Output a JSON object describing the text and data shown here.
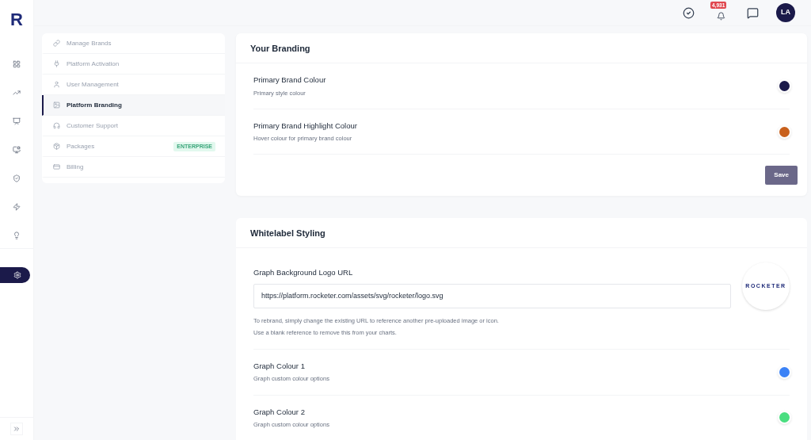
{
  "logo": "R",
  "rail": [
    {
      "kind": "grid",
      "selected": false
    },
    {
      "kind": "chart",
      "selected": false
    },
    {
      "kind": "tag",
      "selected": false
    },
    {
      "kind": "monitor",
      "selected": false
    },
    {
      "kind": "shield",
      "selected": false
    },
    {
      "kind": "zap",
      "selected": false
    },
    {
      "kind": "bulb",
      "selected": false
    },
    {
      "kind": "settings",
      "selected": true
    }
  ],
  "header": {
    "notification_count": "4,931",
    "avatar": "LA"
  },
  "settings_menu": [
    {
      "label": "Manage Brands",
      "kind": "link",
      "selected": false
    },
    {
      "label": "Platform Activation",
      "kind": "plug",
      "selected": false
    },
    {
      "label": "User Management",
      "kind": "user",
      "selected": false
    },
    {
      "label": "Platform Branding",
      "kind": "image",
      "selected": true
    },
    {
      "label": "Customer Support",
      "kind": "headphones",
      "selected": false
    },
    {
      "label": "Packages",
      "kind": "package",
      "selected": false,
      "badge": "ENTERPRISE"
    },
    {
      "label": "Billing",
      "kind": "billing",
      "selected": false
    }
  ],
  "branding": {
    "title": "Your Branding",
    "rows": [
      {
        "label": "Primary Brand Colour",
        "hint": "Primary style colour",
        "color": "#1b1a4a"
      },
      {
        "label": "Primary Brand Highlight Colour",
        "hint": "Hover colour for primary brand colour",
        "color": "#c8601c"
      }
    ],
    "save": "Save"
  },
  "whitelabel": {
    "title": "Whitelabel Styling",
    "logo_url": {
      "label": "Graph Background Logo URL",
      "value": "https://platform.rocketer.com/assets/svg/rocketer/logo.svg",
      "help": [
        "To rebrand, simply change the existing URL to reference another pre-uploaded image or icon.",
        "Use a blank reference to remove this from your charts."
      ],
      "preview": "ROCKETER"
    },
    "rows": [
      {
        "label": "Graph Colour 1",
        "hint": "Graph custom colour options",
        "color": "#3b82f6"
      },
      {
        "label": "Graph Colour 2",
        "hint": "Graph custom colour options",
        "color": "#4ade80"
      }
    ]
  }
}
